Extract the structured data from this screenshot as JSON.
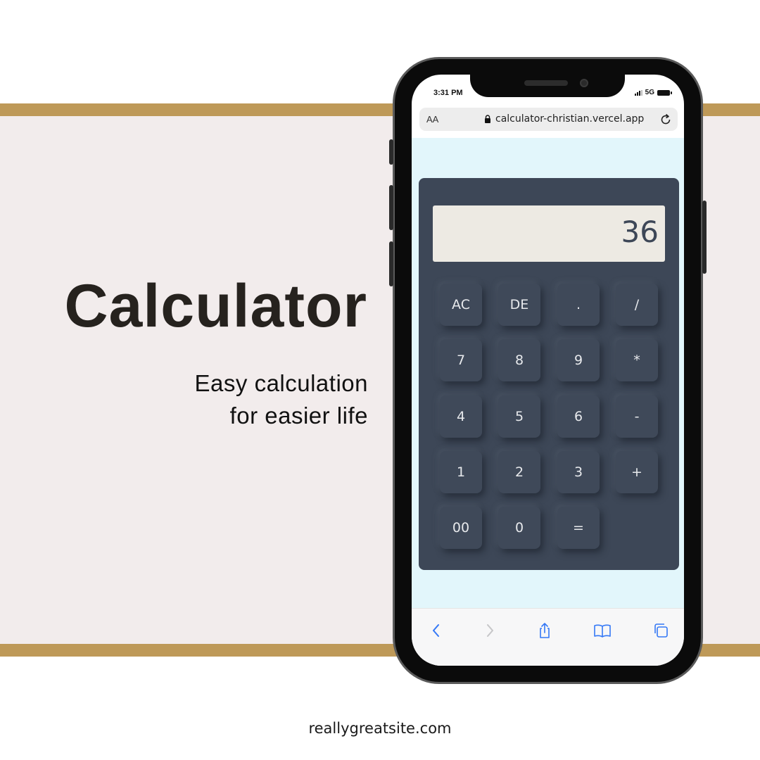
{
  "hero": {
    "title": "Calculator",
    "subtitle_line1": "Easy calculation",
    "subtitle_line2": "for easier life"
  },
  "footer": {
    "url": "reallygreatsite.com"
  },
  "status_bar": {
    "time": "3:31 PM",
    "network": "5G"
  },
  "browser": {
    "text_size_label": "AA",
    "url": "calculator-christian.vercel.app"
  },
  "calculator": {
    "display_value": "36",
    "keys": [
      "AC",
      "DE",
      ".",
      "/",
      "7",
      "8",
      "9",
      "*",
      "4",
      "5",
      "6",
      "-",
      "1",
      "2",
      "3",
      "+",
      "00",
      "0",
      "="
    ]
  },
  "colors": {
    "accent_band": "#be9958",
    "band_background": "#f2ecec",
    "calculator_body": "#3d4757",
    "display_background": "#edeae3",
    "webview_background": "#e2f6fb",
    "toolbar_icon": "#3478f6"
  },
  "toolbar_icons": [
    "back-icon",
    "forward-icon",
    "share-icon",
    "bookmarks-icon",
    "tabs-icon"
  ]
}
